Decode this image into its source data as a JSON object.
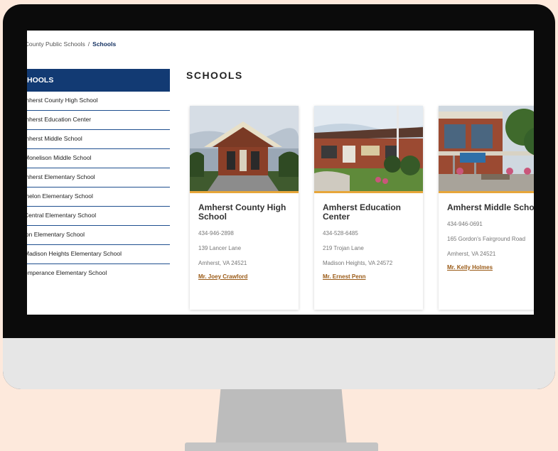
{
  "breadcrumb": {
    "parent": "t County Public Schools",
    "separator": "/",
    "current": "Schools"
  },
  "sidebar": {
    "header": "HOOLS",
    "items": [
      {
        "label": "mherst County High School"
      },
      {
        "label": "mherst Education Center"
      },
      {
        "label": "mherst Middle School"
      },
      {
        "label": "Monelison Middle School"
      },
      {
        "label": "mherst Elementary School"
      },
      {
        "label": "melon Elementary School"
      },
      {
        "label": "Central Elementary School"
      },
      {
        "label": "lon Elementary School"
      },
      {
        "label": "Madison Heights Elementary School"
      },
      {
        "label": "emperance Elementary School"
      }
    ]
  },
  "main": {
    "title": "SCHOOLS",
    "cards": [
      {
        "name": "Amherst County High School",
        "phone": "434-946-2898",
        "address": "139 Lancer Lane",
        "city": "Amherst, VA 24521",
        "principal": "Mr. Joey Crawford"
      },
      {
        "name": "Amherst Education Center",
        "phone": "434-528-6485",
        "address": "219 Trojan Lane",
        "city": "Madison Heights, VA 24572",
        "principal": "Mr. Ernest Penn"
      },
      {
        "name": "Amherst Middle Schoo",
        "phone": "434-946-0691",
        "address": "165 Gordon's Fairground Road",
        "city": "Amherst, VA 24521",
        "principal": "Mr. Kelly Holmes"
      }
    ]
  },
  "colors": {
    "sidebar_header": "#123a73",
    "accent": "#e7a63a",
    "link": "#9a5a16",
    "background": "#fde9dc"
  }
}
